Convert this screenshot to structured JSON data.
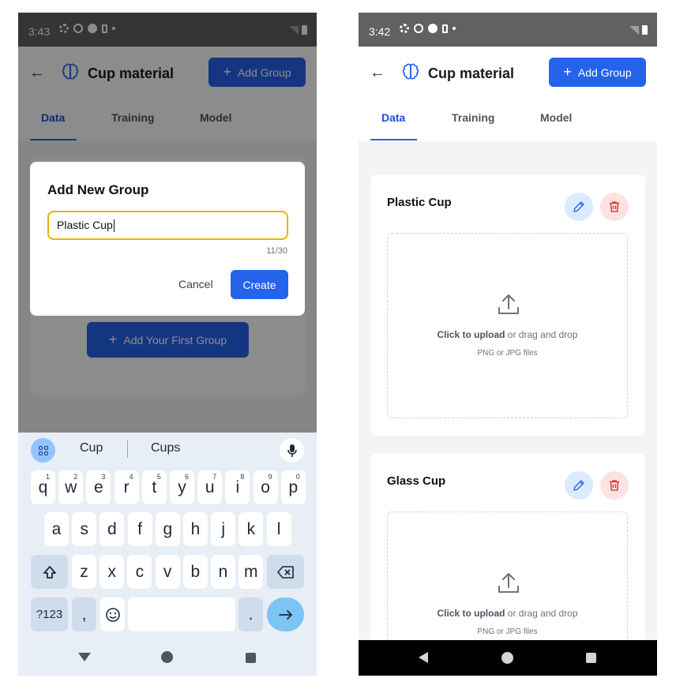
{
  "left_screen": {
    "status": {
      "time": "3:43"
    },
    "appbar": {
      "title": "Cup material",
      "add_group_label": "Add Group"
    },
    "tabs": [
      {
        "label": "Data"
      },
      {
        "label": "Training"
      },
      {
        "label": "Model"
      }
    ],
    "empty_state": {
      "add_first_group_label": "Add Your First Group"
    },
    "dialog": {
      "title": "Add New Group",
      "input_value": "Plastic Cup",
      "char_count": "11/30",
      "cancel_label": "Cancel",
      "create_label": "Create"
    },
    "keyboard": {
      "suggestions": [
        "Cup",
        "Cups"
      ],
      "row1": [
        {
          "key": "q",
          "hint": "1"
        },
        {
          "key": "w",
          "hint": "2"
        },
        {
          "key": "e",
          "hint": "3"
        },
        {
          "key": "r",
          "hint": "4"
        },
        {
          "key": "t",
          "hint": "5"
        },
        {
          "key": "y",
          "hint": "6"
        },
        {
          "key": "u",
          "hint": "7"
        },
        {
          "key": "i",
          "hint": "8"
        },
        {
          "key": "o",
          "hint": "9"
        },
        {
          "key": "p",
          "hint": "0"
        }
      ],
      "row2": [
        "a",
        "s",
        "d",
        "f",
        "g",
        "h",
        "j",
        "k",
        "l"
      ],
      "row3": [
        "z",
        "x",
        "c",
        "v",
        "b",
        "n",
        "m"
      ],
      "symbols_label": "?123",
      "comma_label": ",",
      "period_label": "."
    }
  },
  "right_screen": {
    "status": {
      "time": "3:42"
    },
    "appbar": {
      "title": "Cup material",
      "add_group_label": "Add Group"
    },
    "tabs": [
      {
        "label": "Data"
      },
      {
        "label": "Training"
      },
      {
        "label": "Model"
      }
    ],
    "groups": [
      {
        "name": "Plastic Cup",
        "upload_link": "Click to upload",
        "upload_rest": " or drag and drop",
        "upload_hint": "PNG or JPG files"
      },
      {
        "name": "Glass Cup",
        "upload_link": "Click to upload",
        "upload_rest": " or drag and drop",
        "upload_hint": "PNG or JPG files"
      }
    ]
  },
  "colors": {
    "primary": "#2563eb",
    "danger": "#dc2626",
    "focus_border": "#eab308"
  },
  "icons": [
    "back-arrow-icon",
    "brain-icon",
    "plus-icon",
    "pencil-icon",
    "trash-icon",
    "upload-icon",
    "mic-icon",
    "apps-grid-icon",
    "shift-icon",
    "backspace-icon",
    "emoji-icon",
    "enter-arrow-icon"
  ]
}
